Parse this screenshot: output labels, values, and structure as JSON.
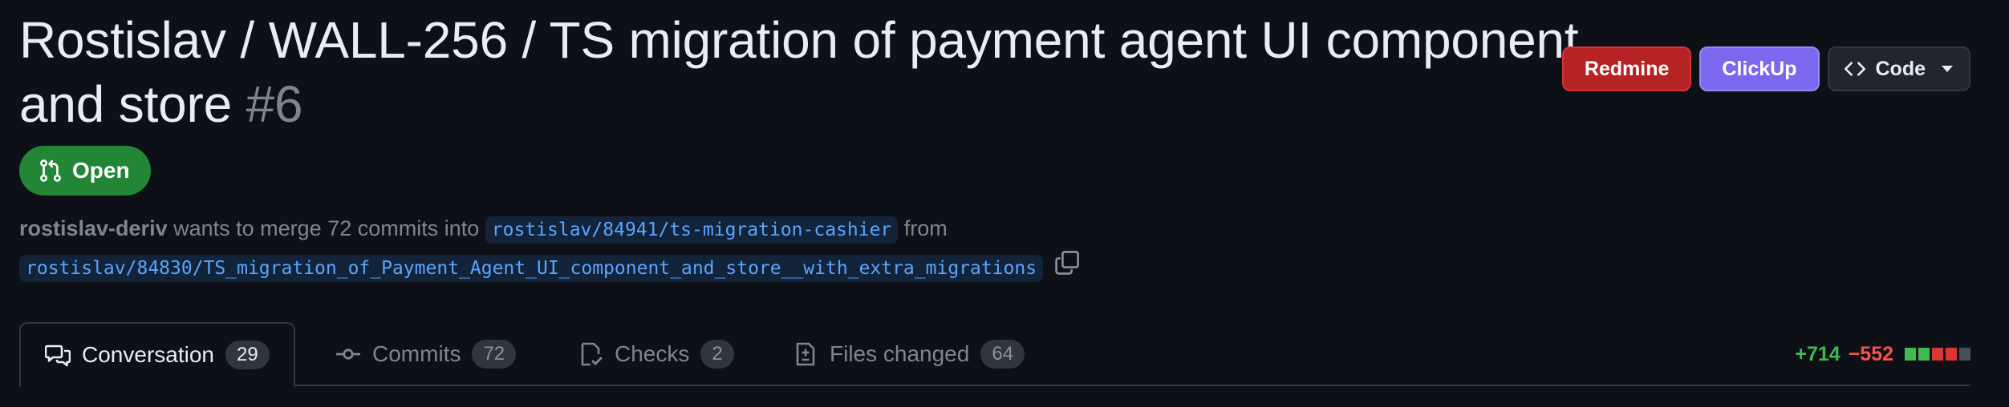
{
  "title": {
    "text": "Rostislav / WALL-256 / TS migration of payment agent UI component and store",
    "number": "#6"
  },
  "actions": {
    "redmine_label": "Redmine",
    "clickup_label": "ClickUp",
    "code_label": "Code"
  },
  "state": {
    "label": "Open"
  },
  "merge_info": {
    "author": "rostislav-deriv",
    "text_before": "wants to merge 72 commits into",
    "base_branch": "rostislav/84941/ts-migration-cashier",
    "text_from": "from",
    "head_branch": "rostislav/84830/TS_migration_of_Payment_Agent_UI_component_and_store__with_extra_migrations"
  },
  "tabs": [
    {
      "label": "Conversation",
      "count": "29",
      "icon": "comment-discussion-icon",
      "selected": true
    },
    {
      "label": "Commits",
      "count": "72",
      "icon": "git-commit-icon",
      "selected": false
    },
    {
      "label": "Checks",
      "count": "2",
      "icon": "checklist-icon",
      "selected": false
    },
    {
      "label": "Files changed",
      "count": "64",
      "icon": "file-diff-icon",
      "selected": false
    }
  ],
  "diffstat": {
    "additions": "+714",
    "deletions": "−552",
    "blocks": [
      "added",
      "added",
      "deleted",
      "deleted",
      "neutral"
    ]
  },
  "colors": {
    "open_green": "#238636",
    "redmine_red": "#b62324",
    "clickup_purple": "#7b68ee",
    "link_blue": "#58a6ff",
    "add_green": "#3fb950",
    "del_red": "#f85149"
  }
}
